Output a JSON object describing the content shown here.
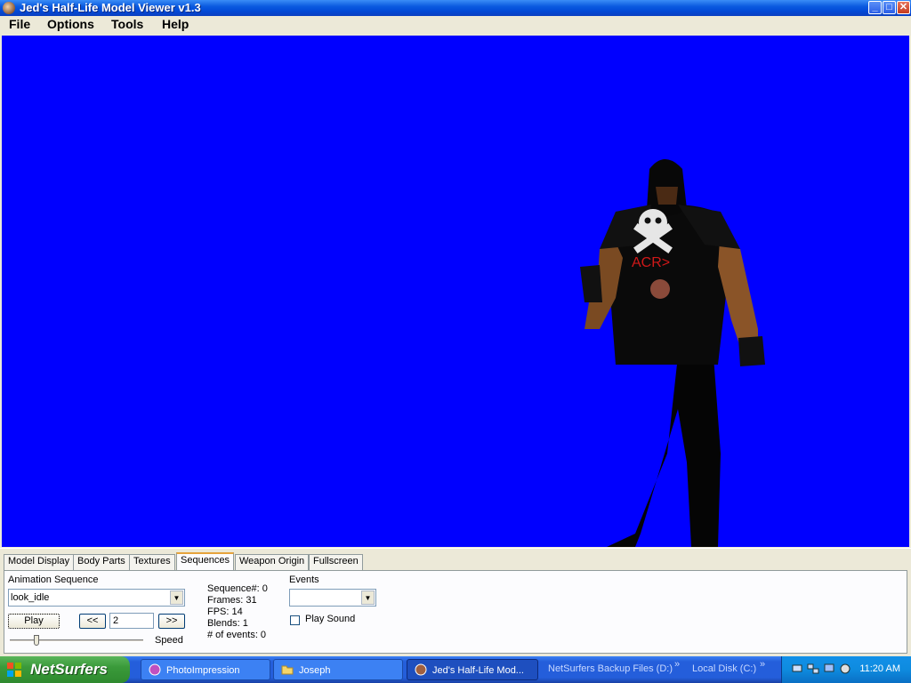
{
  "window": {
    "title": "Jed's Half-Life Model Viewer v1.3",
    "controls": {
      "minimize": "_",
      "maximize": "□",
      "close": "✕"
    }
  },
  "menu": [
    "File",
    "Options",
    "Tools",
    "Help"
  ],
  "viewport": {
    "background_color": "#0000ff",
    "shirt_text": "ACR>"
  },
  "tabs": [
    {
      "label": "Model Display",
      "active": false
    },
    {
      "label": "Body Parts",
      "active": false
    },
    {
      "label": "Textures",
      "active": false
    },
    {
      "label": "Sequences",
      "active": true
    },
    {
      "label": "Weapon Origin",
      "active": false
    },
    {
      "label": "Fullscreen",
      "active": false
    }
  ],
  "sequences_panel": {
    "animation_sequence_label": "Animation Sequence",
    "animation_sequence_value": "look_idle",
    "play_button": "Play",
    "prev_button": "<<",
    "frame_value": "2",
    "next_button": ">>",
    "speed_label": "Speed",
    "speed_fraction": 0.2,
    "info": {
      "sequence": "Sequence#: 0",
      "frames": "Frames: 31",
      "fps": "FPS: 14",
      "blends": "Blends: 1",
      "events": "# of events: 0"
    },
    "events_label": "Events",
    "events_value": "",
    "play_sound_label": "Play Sound",
    "play_sound_checked": false
  },
  "taskbar": {
    "start_label": "NetSurfers",
    "tasks": [
      {
        "label": "PhotoImpression",
        "icon": "photoimpression-icon",
        "active": false
      },
      {
        "label": "Joseph",
        "icon": "folder-icon",
        "active": false
      },
      {
        "label": "Jed's Half-Life Mod...",
        "icon": "hlmv-app-icon",
        "active": true
      }
    ],
    "quick_links": [
      "NetSurfers Backup Files (D:)",
      "»",
      "Local Disk (C:)",
      "»"
    ],
    "clock": "11:20 AM"
  }
}
